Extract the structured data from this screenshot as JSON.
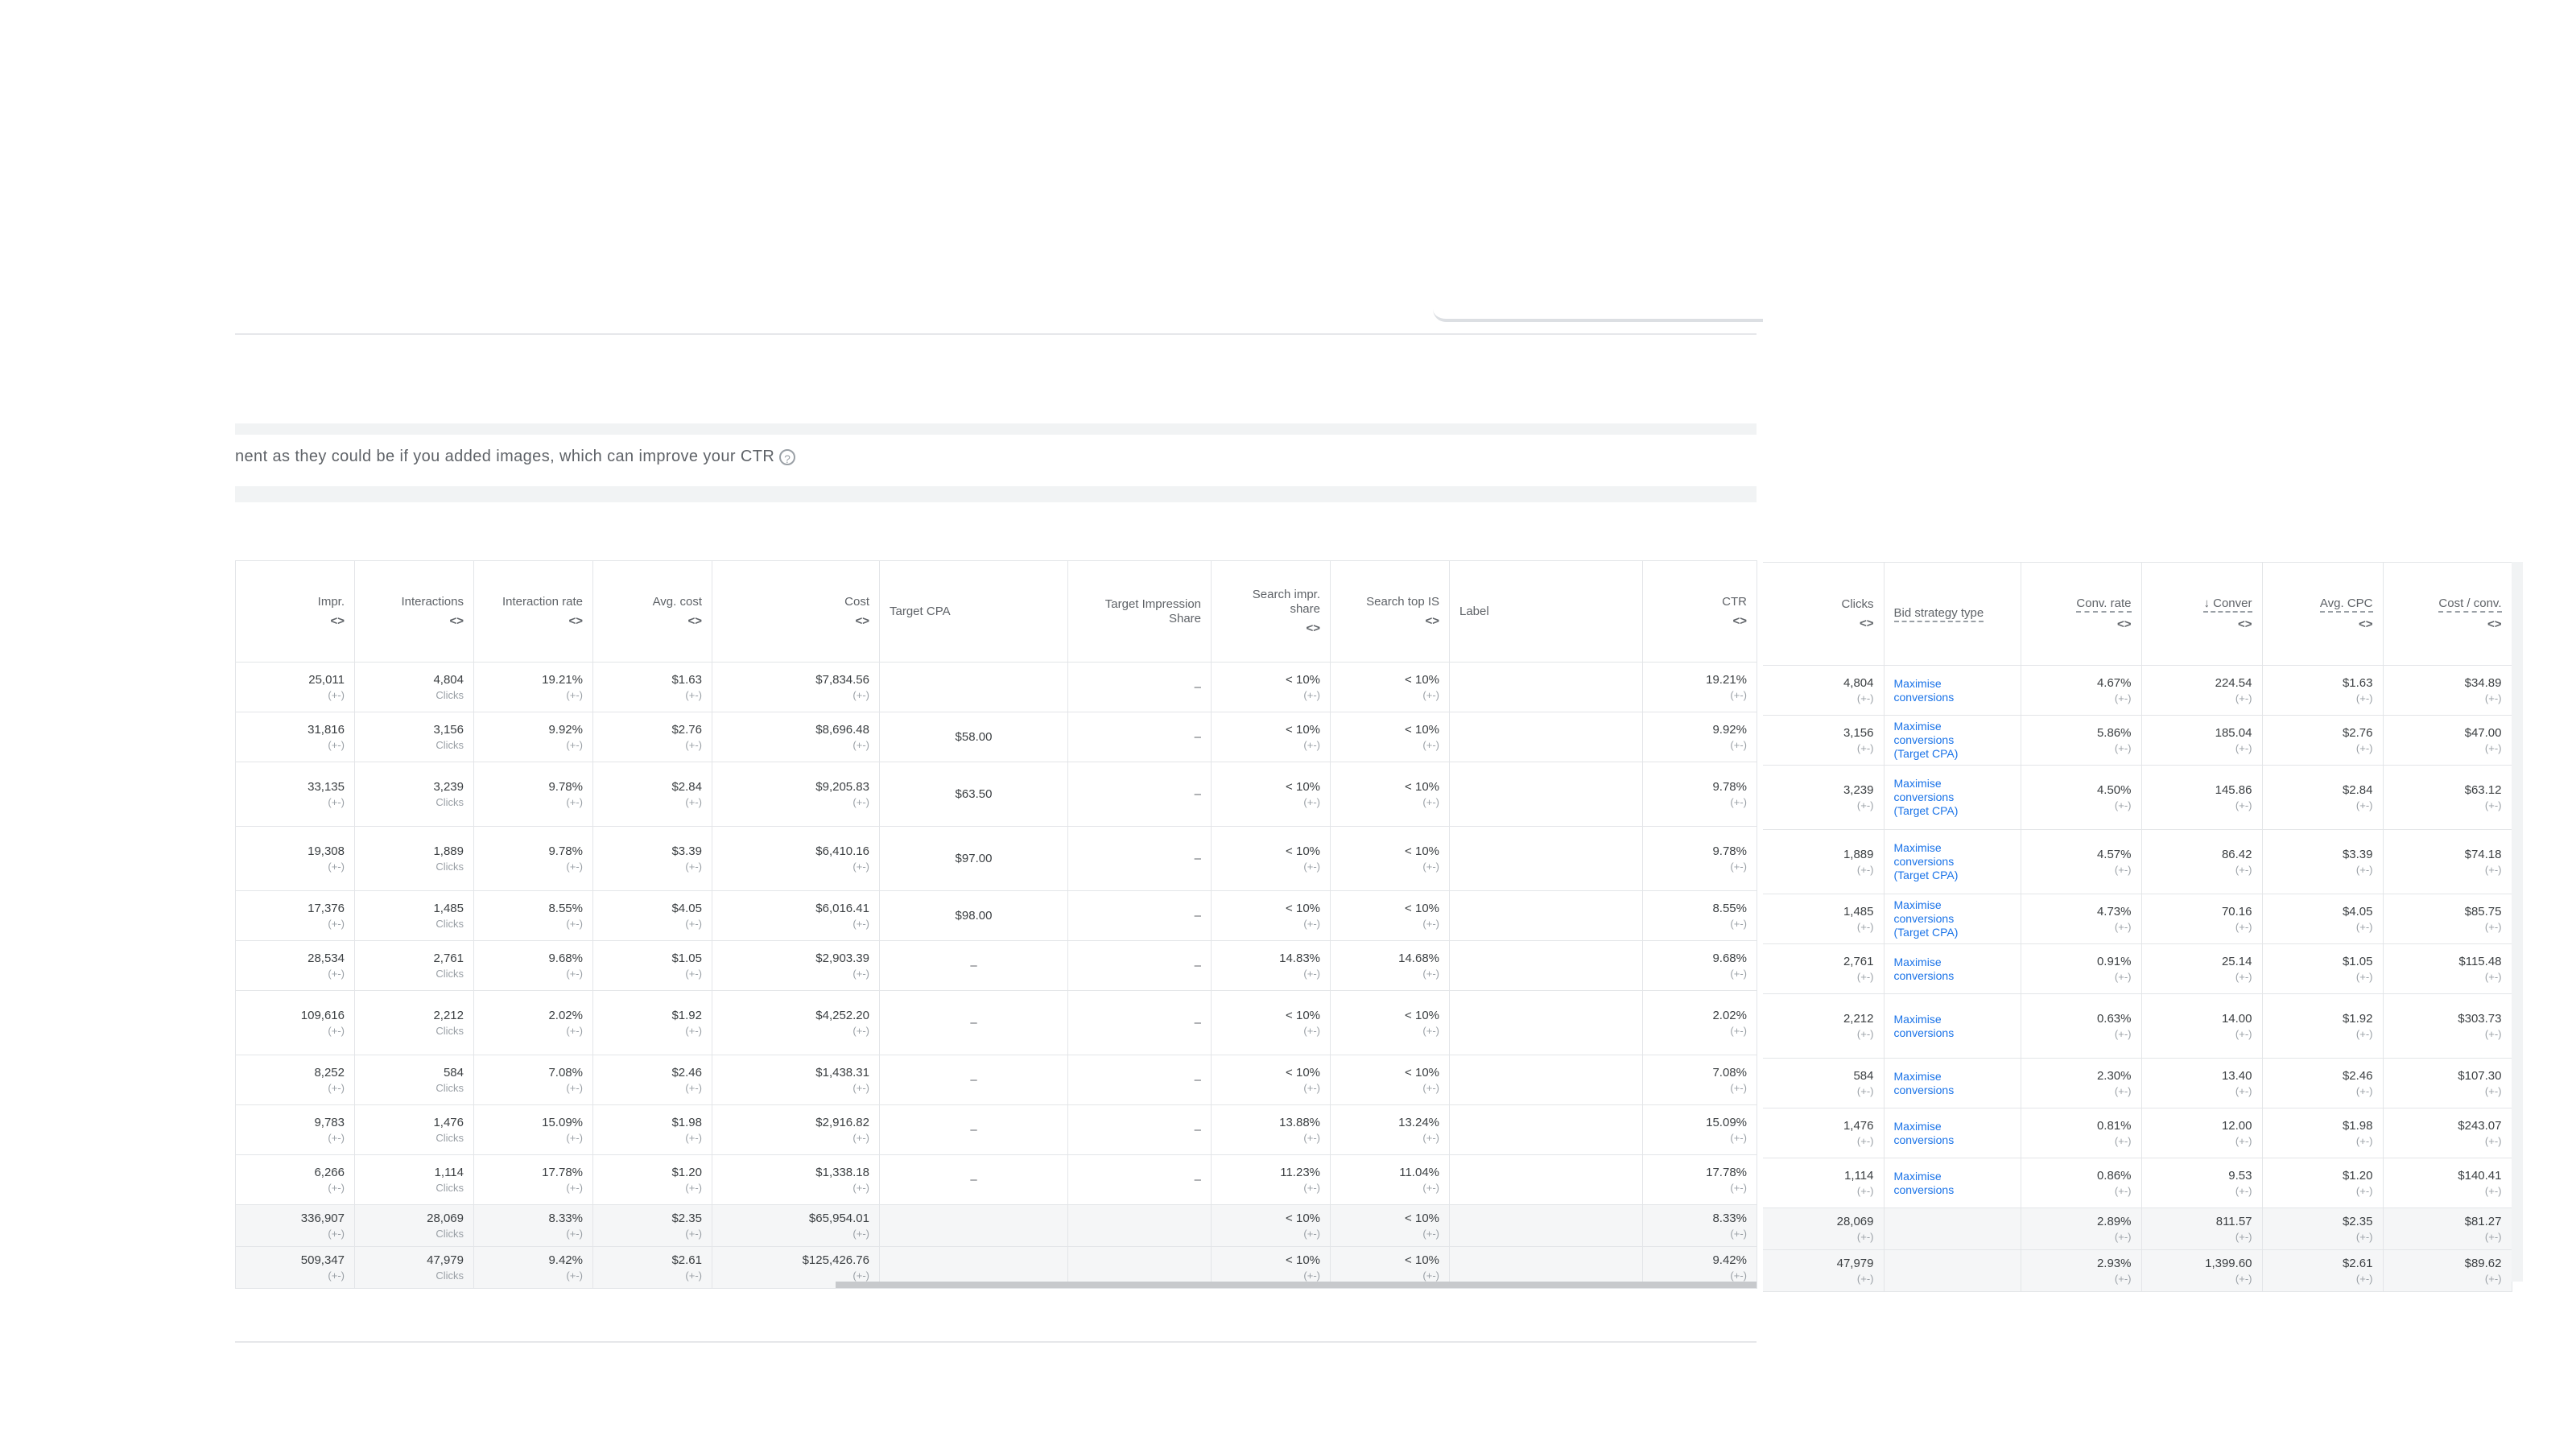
{
  "notice": {
    "text": "nent as they could be if you added images, which can improve your CTR",
    "icon": "info-icon"
  },
  "left_table": {
    "headers": [
      {
        "label": "Impr.",
        "sortable": true
      },
      {
        "label": "Interactions",
        "sortable": true
      },
      {
        "label": "Interaction rate",
        "sortable": true
      },
      {
        "label": "Avg. cost",
        "sortable": true
      },
      {
        "label": "Cost",
        "sortable": true
      },
      {
        "label": "Target CPA",
        "sortable": false
      },
      {
        "label": "Target Impression Share",
        "sortable": false
      },
      {
        "label": "Search impr. share",
        "sortable": true
      },
      {
        "label": "Search top IS",
        "sortable": true
      },
      {
        "label": "Label",
        "sortable": false
      },
      {
        "label": "CTR",
        "sortable": true
      }
    ],
    "arrows": "<>",
    "delta": "(+-)",
    "unit": "Clicks",
    "dash": "–",
    "rows": [
      {
        "impr": "25,011",
        "inter": "4,804",
        "rate": "19.21%",
        "avg": "$1.63",
        "cost": "$7,834.56",
        "tcpa": "",
        "tis": "–",
        "sis": "< 10%",
        "stop": "< 10%",
        "label": "",
        "ctr": "19.21%"
      },
      {
        "impr": "31,816",
        "inter": "3,156",
        "rate": "9.92%",
        "avg": "$2.76",
        "cost": "$8,696.48",
        "tcpa": "$58.00",
        "tis": "–",
        "sis": "< 10%",
        "stop": "< 10%",
        "label": "",
        "ctr": "9.92%"
      },
      {
        "impr": "33,135",
        "inter": "3,239",
        "rate": "9.78%",
        "avg": "$2.84",
        "cost": "$9,205.83",
        "tcpa": "$63.50",
        "tis": "–",
        "sis": "< 10%",
        "stop": "< 10%",
        "label": "",
        "ctr": "9.78%"
      },
      {
        "impr": "19,308",
        "inter": "1,889",
        "rate": "9.78%",
        "avg": "$3.39",
        "cost": "$6,410.16",
        "tcpa": "$97.00",
        "tis": "–",
        "sis": "< 10%",
        "stop": "< 10%",
        "label": "",
        "ctr": "9.78%"
      },
      {
        "impr": "17,376",
        "inter": "1,485",
        "rate": "8.55%",
        "avg": "$4.05",
        "cost": "$6,016.41",
        "tcpa": "$98.00",
        "tis": "–",
        "sis": "< 10%",
        "stop": "< 10%",
        "label": "",
        "ctr": "8.55%"
      },
      {
        "impr": "28,534",
        "inter": "2,761",
        "rate": "9.68%",
        "avg": "$1.05",
        "cost": "$2,903.39",
        "tcpa": "–",
        "tis": "–",
        "sis": "14.83%",
        "stop": "14.68%",
        "label": "",
        "ctr": "9.68%"
      },
      {
        "impr": "109,616",
        "inter": "2,212",
        "rate": "2.02%",
        "avg": "$1.92",
        "cost": "$4,252.20",
        "tcpa": "–",
        "tis": "–",
        "sis": "< 10%",
        "stop": "< 10%",
        "label": "",
        "ctr": "2.02%"
      },
      {
        "impr": "8,252",
        "inter": "584",
        "rate": "7.08%",
        "avg": "$2.46",
        "cost": "$1,438.31",
        "tcpa": "–",
        "tis": "–",
        "sis": "< 10%",
        "stop": "< 10%",
        "label": "",
        "ctr": "7.08%"
      },
      {
        "impr": "9,783",
        "inter": "1,476",
        "rate": "15.09%",
        "avg": "$1.98",
        "cost": "$2,916.82",
        "tcpa": "–",
        "tis": "–",
        "sis": "13.88%",
        "stop": "13.24%",
        "label": "",
        "ctr": "15.09%"
      },
      {
        "impr": "6,266",
        "inter": "1,114",
        "rate": "17.78%",
        "avg": "$1.20",
        "cost": "$1,338.18",
        "tcpa": "–",
        "tis": "–",
        "sis": "11.23%",
        "stop": "11.04%",
        "label": "",
        "ctr": "17.78%"
      }
    ],
    "totals": [
      {
        "impr": "336,907",
        "inter": "28,069",
        "rate": "8.33%",
        "avg": "$2.35",
        "cost": "$65,954.01",
        "sis": "< 10%",
        "stop": "< 10%",
        "ctr": "8.33%"
      },
      {
        "impr": "509,347",
        "inter": "47,979",
        "rate": "9.42%",
        "avg": "$2.61",
        "cost": "$125,426.76",
        "sis": "< 10%",
        "stop": "< 10%",
        "ctr": "9.42%"
      }
    ]
  },
  "right_table": {
    "headers": [
      {
        "label": "Clicks",
        "sortable": true
      },
      {
        "label": "Bid strategy type",
        "sortable": false
      },
      {
        "label": "Conv. rate",
        "sortable": true
      },
      {
        "label": "↓ Conver",
        "sortable": true
      },
      {
        "label": "Avg. CPC",
        "sortable": true
      },
      {
        "label": "Cost / conv.",
        "sortable": true
      }
    ],
    "rows": [
      {
        "clicks": "4,804",
        "bid": [
          "Maximise",
          "conversions"
        ],
        "crate": "4.67%",
        "conv": "224.54",
        "cpc": "$1.63",
        "cpconv": "$34.89"
      },
      {
        "clicks": "3,156",
        "bid": [
          "Maximise",
          "conversions",
          "(Target CPA)"
        ],
        "crate": "5.86%",
        "conv": "185.04",
        "cpc": "$2.76",
        "cpconv": "$47.00"
      },
      {
        "clicks": "3,239",
        "bid": [
          "Maximise",
          "conversions",
          "(Target CPA)"
        ],
        "crate": "4.50%",
        "conv": "145.86",
        "cpc": "$2.84",
        "cpconv": "$63.12"
      },
      {
        "clicks": "1,889",
        "bid": [
          "Maximise",
          "conversions",
          "(Target CPA)"
        ],
        "crate": "4.57%",
        "conv": "86.42",
        "cpc": "$3.39",
        "cpconv": "$74.18"
      },
      {
        "clicks": "1,485",
        "bid": [
          "Maximise",
          "conversions",
          "(Target CPA)"
        ],
        "crate": "4.73%",
        "conv": "70.16",
        "cpc": "$4.05",
        "cpconv": "$85.75"
      },
      {
        "clicks": "2,761",
        "bid": [
          "Maximise",
          "conversions"
        ],
        "crate": "0.91%",
        "conv": "25.14",
        "cpc": "$1.05",
        "cpconv": "$115.48"
      },
      {
        "clicks": "2,212",
        "bid": [
          "Maximise",
          "conversions"
        ],
        "crate": "0.63%",
        "conv": "14.00",
        "cpc": "$1.92",
        "cpconv": "$303.73"
      },
      {
        "clicks": "584",
        "bid": [
          "Maximise",
          "conversions"
        ],
        "crate": "2.30%",
        "conv": "13.40",
        "cpc": "$2.46",
        "cpconv": "$107.30"
      },
      {
        "clicks": "1,476",
        "bid": [
          "Maximise",
          "conversions"
        ],
        "crate": "0.81%",
        "conv": "12.00",
        "cpc": "$1.98",
        "cpconv": "$243.07"
      },
      {
        "clicks": "1,114",
        "bid": [
          "Maximise",
          "conversions"
        ],
        "crate": "0.86%",
        "conv": "9.53",
        "cpc": "$1.20",
        "cpconv": "$140.41"
      }
    ],
    "totals": [
      {
        "clicks": "28,069",
        "crate": "2.89%",
        "conv": "811.57",
        "cpc": "$2.35",
        "cpconv": "$81.27"
      },
      {
        "clicks": "47,979",
        "crate": "2.93%",
        "conv": "1,399.60",
        "cpc": "$2.61",
        "cpconv": "$89.62"
      }
    ]
  },
  "colors": {
    "link": "#1a73e8",
    "border": "#e3e5e8",
    "muted": "#9aa0a6",
    "total_bg": "#f5f6f7"
  }
}
